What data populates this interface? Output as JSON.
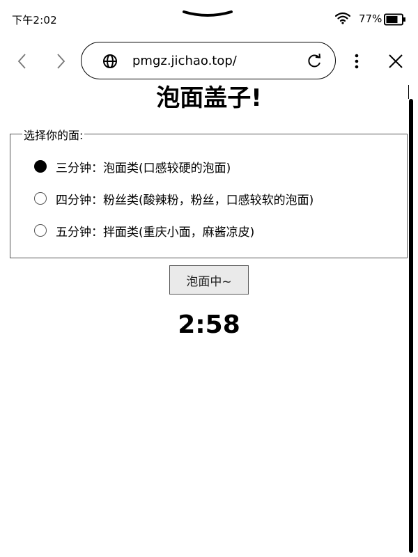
{
  "status_bar": {
    "time": "下午2:02",
    "battery": "77%"
  },
  "browser": {
    "url": "pmgz.jichao.top/"
  },
  "page": {
    "title": "泡面盖子!",
    "legend": "选择你的面:",
    "options": [
      {
        "label": "三分钟：泡面类(口感较硬的泡面)",
        "checked": true
      },
      {
        "label": "四分钟：粉丝类(酸辣粉，粉丝，口感较软的泡面)",
        "checked": false
      },
      {
        "label": "五分钟：拌面类(重庆小面，麻酱凉皮)",
        "checked": false
      }
    ],
    "button_label": "泡面中~",
    "timer": "2:58"
  }
}
